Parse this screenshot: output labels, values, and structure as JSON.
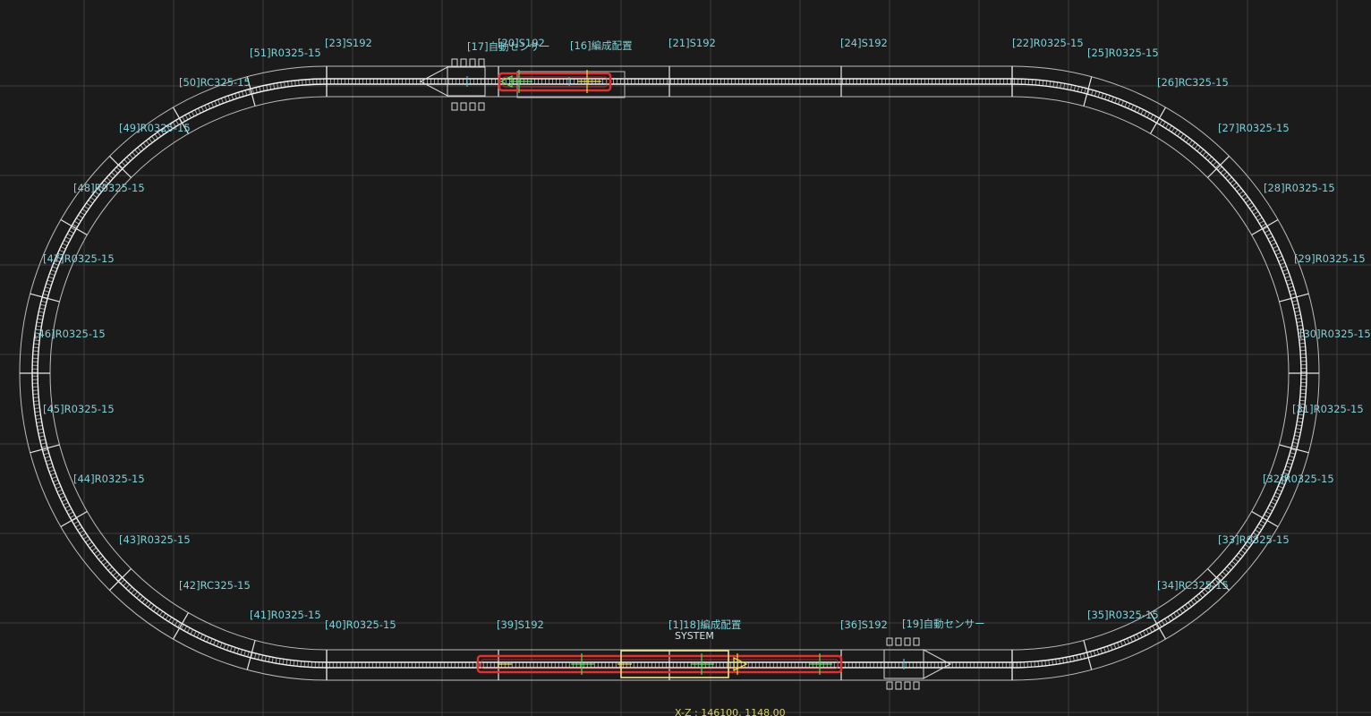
{
  "labels": {
    "t23": "[23]S192",
    "t17": "[17]自動センサー",
    "t20": "[20]S192",
    "t16": "[16]編成配置",
    "t21": "[21]S192",
    "t24": "[24]S192",
    "t22": "[22]R0325-15",
    "t25": "[25]R0325-15",
    "t26": "[26]RC325-15",
    "t27": "[27]R0325-15",
    "t28": "[28]R0325-15",
    "t29": "[29]R0325-15",
    "t30": "[30]R0325-15",
    "t31": "[31]R0325-15",
    "t32": "[32]R0325-15",
    "t33": "[33]R0325-15",
    "t34": "[34]RC325-15",
    "t35": "[35]R0325-15",
    "t36": "[36]S192",
    "t19": "[19]自動センサー",
    "t18": "[1]18]編成配置",
    "system": "SYSTEM",
    "t39": "[39]S192",
    "t40": "[40]R0325-15",
    "t41": "[41]R0325-15",
    "t42": "[42]RC325-15",
    "t43": "[43]R0325-15",
    "t44": "[44]R0325-15",
    "t45": "[45]R0325-15",
    "t46": "[46]R0325-15",
    "t47": "[47]R0325-15",
    "t48": "[48]R0325-15",
    "t49": "[49]R0325-15",
    "t50": "[50]RC325-15",
    "t51": "[51]R0325-15"
  },
  "status": {
    "coordinate": "X-Z : 146100, 1148.00"
  },
  "colors": {
    "background": "#1b1b1b",
    "grid": "#3d3d3d",
    "track": "#e8e8e8",
    "label": "#7fd0d6",
    "train_outline": "#e03030",
    "selection": "#f0e68c",
    "sensor": "#e8e8e8"
  }
}
